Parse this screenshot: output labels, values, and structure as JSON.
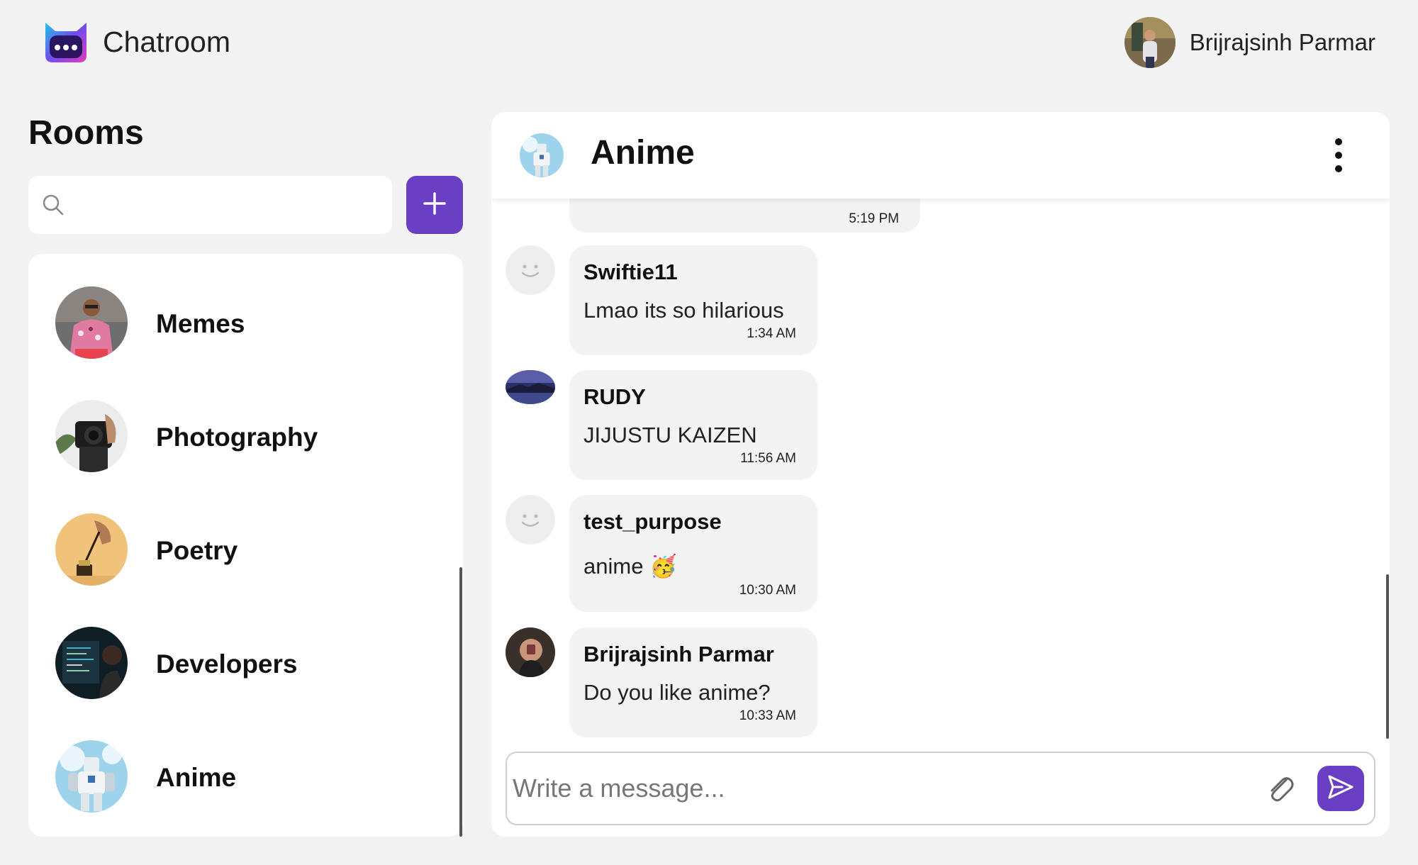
{
  "app": {
    "title": "Chatroom"
  },
  "user": {
    "name": "Brijrajsinh Parmar"
  },
  "rooms": {
    "title": "Rooms",
    "search": {
      "placeholder": "",
      "value": ""
    },
    "items": [
      {
        "name": "Memes"
      },
      {
        "name": "Photography"
      },
      {
        "name": "Poetry"
      },
      {
        "name": "Developers"
      },
      {
        "name": "Anime"
      }
    ]
  },
  "chat": {
    "room_title": "Anime",
    "messages": [
      {
        "author": "",
        "text": "",
        "time": "5:19 PM"
      },
      {
        "author": "Swiftie11",
        "text": "Lmao its so hilarious",
        "time": "1:34 AM"
      },
      {
        "author": "RUDY",
        "text": "JIJUSTU KAIZEN",
        "time": "11:56 AM"
      },
      {
        "author": "test_purpose",
        "text": "anime 🥳",
        "time": "10:30 AM"
      },
      {
        "author": "Brijrajsinh Parmar",
        "text": "Do you like anime?",
        "time": "10:33 AM"
      }
    ],
    "composer": {
      "placeholder": "Write a message...",
      "value": ""
    }
  },
  "colors": {
    "accent": "#6a3fc4",
    "background": "#f3f3f3",
    "bubble": "#f3f3f3"
  },
  "icons": [
    "chatroom-logo-icon",
    "search-icon",
    "plus-icon",
    "more-vertical-icon",
    "smiley-placeholder-icon",
    "paperclip-icon",
    "send-icon"
  ]
}
